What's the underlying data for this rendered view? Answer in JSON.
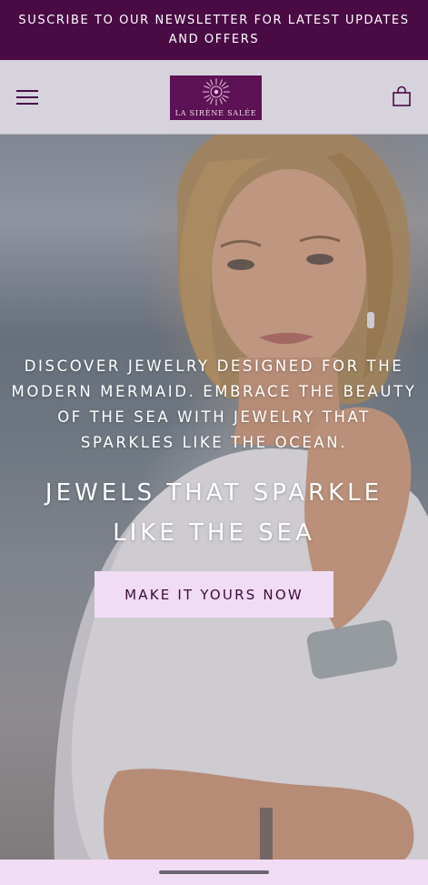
{
  "announcement": {
    "text": "SUSCRIBE TO OUR NEWSLETTER FOR LATEST UPDATES AND OFFERS"
  },
  "header": {
    "logo_text": "LA SIRÈNE SALÉE",
    "menu_icon": "hamburger-menu-icon",
    "cart_icon": "shopping-bag-icon"
  },
  "hero": {
    "tagline": "DISCOVER JEWELRY DESIGNED FOR THE MODERN MERMAID. EMBRACE THE BEAUTY OF THE SEA WITH JEWELRY THAT SPARKLES LIKE THE OCEAN.",
    "heading": "JEWELS THAT SPARKLE LIKE THE SEA",
    "cta_label": "MAKE IT YOURS NOW"
  },
  "colors": {
    "brand_purple": "#4a0b45",
    "logo_purple": "#5c1254",
    "cta_background": "#f1dcf5",
    "header_background": "#d6d3dc"
  }
}
